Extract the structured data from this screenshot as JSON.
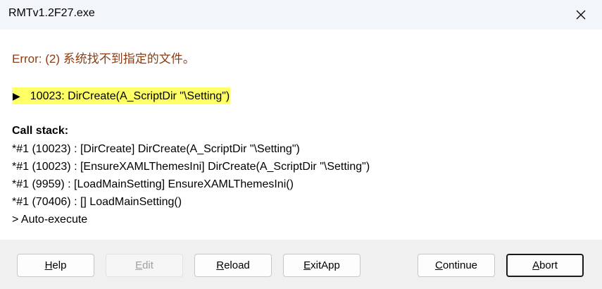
{
  "window": {
    "title": "RMTv1.2F27.exe"
  },
  "error": {
    "message": "Error: (2) 系统找不到指定的文件。",
    "line_arrow": "▶",
    "line_text": "10023: DirCreate(A_ScriptDir \"\\Setting\")"
  },
  "call_stack": {
    "title": "Call stack:",
    "entries": [
      "*#1 (10023) : [DirCreate] DirCreate(A_ScriptDir \"\\Setting\")",
      "*#1 (10023) : [EnsureXAMLThemesIni] DirCreate(A_ScriptDir \"\\Setting\")",
      "*#1 (9959) : [LoadMainSetting] EnsureXAMLThemesIni()",
      "*#1 (70406) : [] LoadMainSetting()",
      "> Auto-execute"
    ]
  },
  "buttons": {
    "help": {
      "mnemonic": "H",
      "rest": "elp"
    },
    "edit": {
      "mnemonic": "E",
      "rest": "dit"
    },
    "reload": {
      "mnemonic": "R",
      "rest": "eload"
    },
    "exitapp": {
      "mnemonic": "E",
      "rest": "xitApp"
    },
    "continue": {
      "mnemonic": "C",
      "rest": "ontinue"
    },
    "abort": {
      "mnemonic": "A",
      "rest": "bort"
    }
  },
  "colors": {
    "error_text": "#8c3c12",
    "highlight": "#ffff66",
    "titlebar": "#f2f6fb",
    "footer": "#f0f0f0"
  },
  "icons": {
    "close": "close-icon"
  }
}
